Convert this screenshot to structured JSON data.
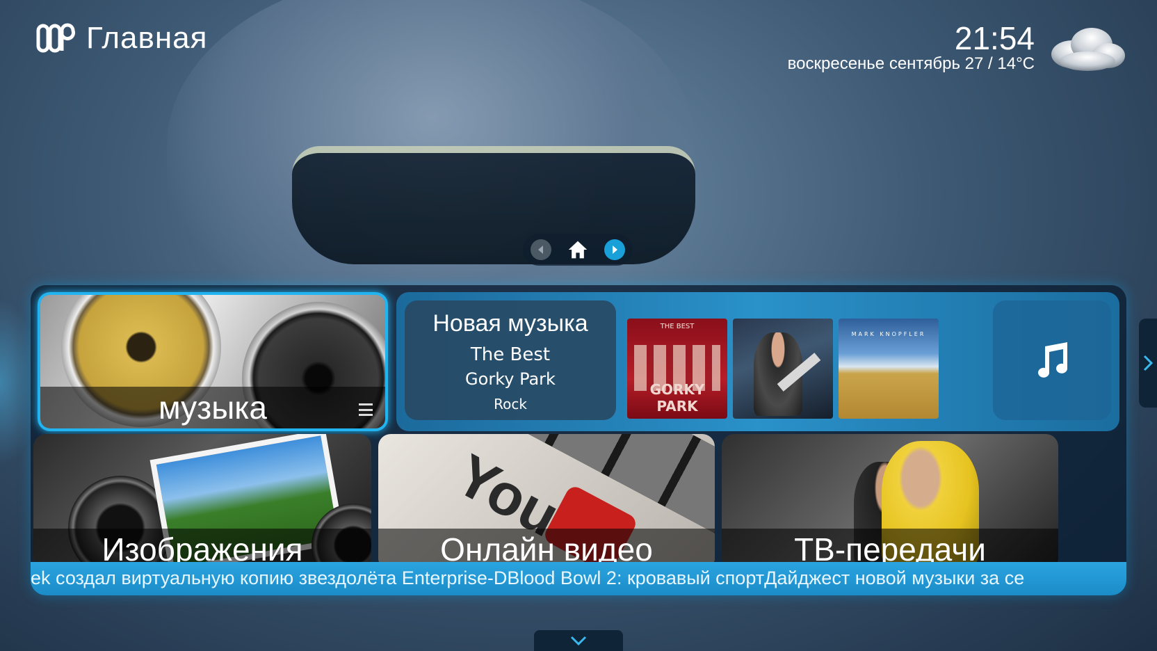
{
  "header": {
    "title": "Главная",
    "time": "21:54",
    "date_weather": "воскресенье сентябрь 27 / 14°C",
    "weather_icon": "cloud-icon"
  },
  "nav": {
    "prev_icon": "arrow-left-icon",
    "home_icon": "home-icon",
    "next_icon": "arrow-right-icon"
  },
  "tiles": {
    "music": {
      "label": "музыка"
    },
    "new_music": {
      "title": "Новая музыка",
      "album": "The Best",
      "artist": "Gorky Park",
      "genre": "Rock"
    },
    "albums": [
      {
        "top": "THE BEST",
        "caption": "GORKY PARK"
      },
      {
        "top": "",
        "caption": ""
      },
      {
        "top": "MARK KNOPFLER",
        "caption": ""
      }
    ],
    "music_note_icon": "music-note-icon",
    "images": {
      "label": "Изображения"
    },
    "online_video": {
      "label": "Онлайн видео"
    },
    "tv": {
      "label": "ТВ-передачи"
    }
  },
  "ticker": {
    "text": "ek создал виртуальную копию звездолёта Enterprise-DBlood Bowl 2: кровавый спортДайджест новой музыки за се"
  },
  "colors": {
    "accent": "#21b4f0",
    "youtube_red": "#c7201d"
  }
}
